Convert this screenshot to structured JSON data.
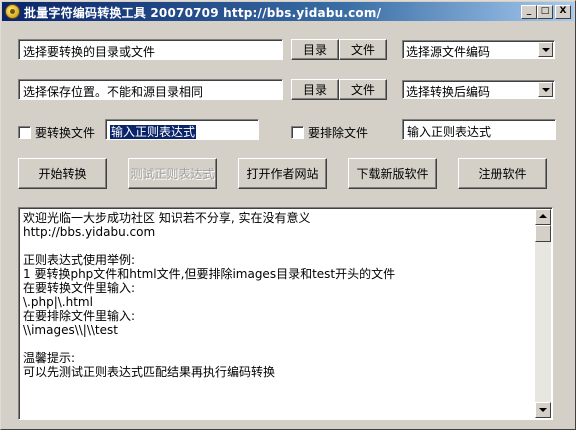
{
  "window": {
    "title": "批量字符编码转换工具 20070709 http://bbs.yidabu.com/",
    "controls": {
      "minimize": "_",
      "maximize": "□",
      "close": "X"
    }
  },
  "source": {
    "path_value": "选择要转换的目录或文件",
    "dir_button": "目录",
    "file_button": "文件",
    "encoding_selected": "选择源文件编码"
  },
  "target": {
    "path_value": "选择保存位置。不能和源目录相同",
    "dir_button": "目录",
    "file_button": "文件",
    "encoding_selected": "选择转换后编码"
  },
  "filters": {
    "include_label": "要转换文件",
    "include_value": "输入正则表达式",
    "exclude_label": "要排除文件",
    "exclude_value": "输入正则表达式"
  },
  "actions": {
    "start": "开始转换",
    "test_regex": "测试正则表达式",
    "open_site": "打开作者网站",
    "download": "下载新版软件",
    "register": "注册软件"
  },
  "log": {
    "lines": [
      "欢迎光临一大步成功社区 知识若不分享, 实在没有意义",
      "http://bbs.yidabu.com",
      "",
      "正则表达式使用举例:",
      "1 要转换php文件和html文件,但要排除images目录和test开头的文件",
      "在要转换文件里输入:",
      "\\.php|\\.html",
      "在要排除文件里输入:",
      "\\\\images\\\\|\\\\test",
      "",
      "温馨提示:",
      "可以先测试正则表达式匹配结果再执行编码转换"
    ]
  }
}
